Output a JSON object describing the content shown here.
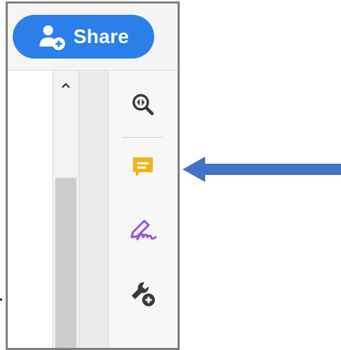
{
  "toolbar": {
    "share_label": "Share"
  },
  "icons": {
    "share": "add-user-icon",
    "scroll_up": "chevron-up-icon",
    "zoom": "zoom-icon",
    "comment": "comment-icon",
    "fill_sign": "fill-and-sign-icon",
    "more_tools": "more-tools-icon",
    "pointer": "arrow-left-icon"
  },
  "colors": {
    "share_button": "#2a7fe8",
    "comment_icon": "#f0b41c",
    "fill_sign_icon": "#9b52d6",
    "arrow": "#4472c4"
  }
}
